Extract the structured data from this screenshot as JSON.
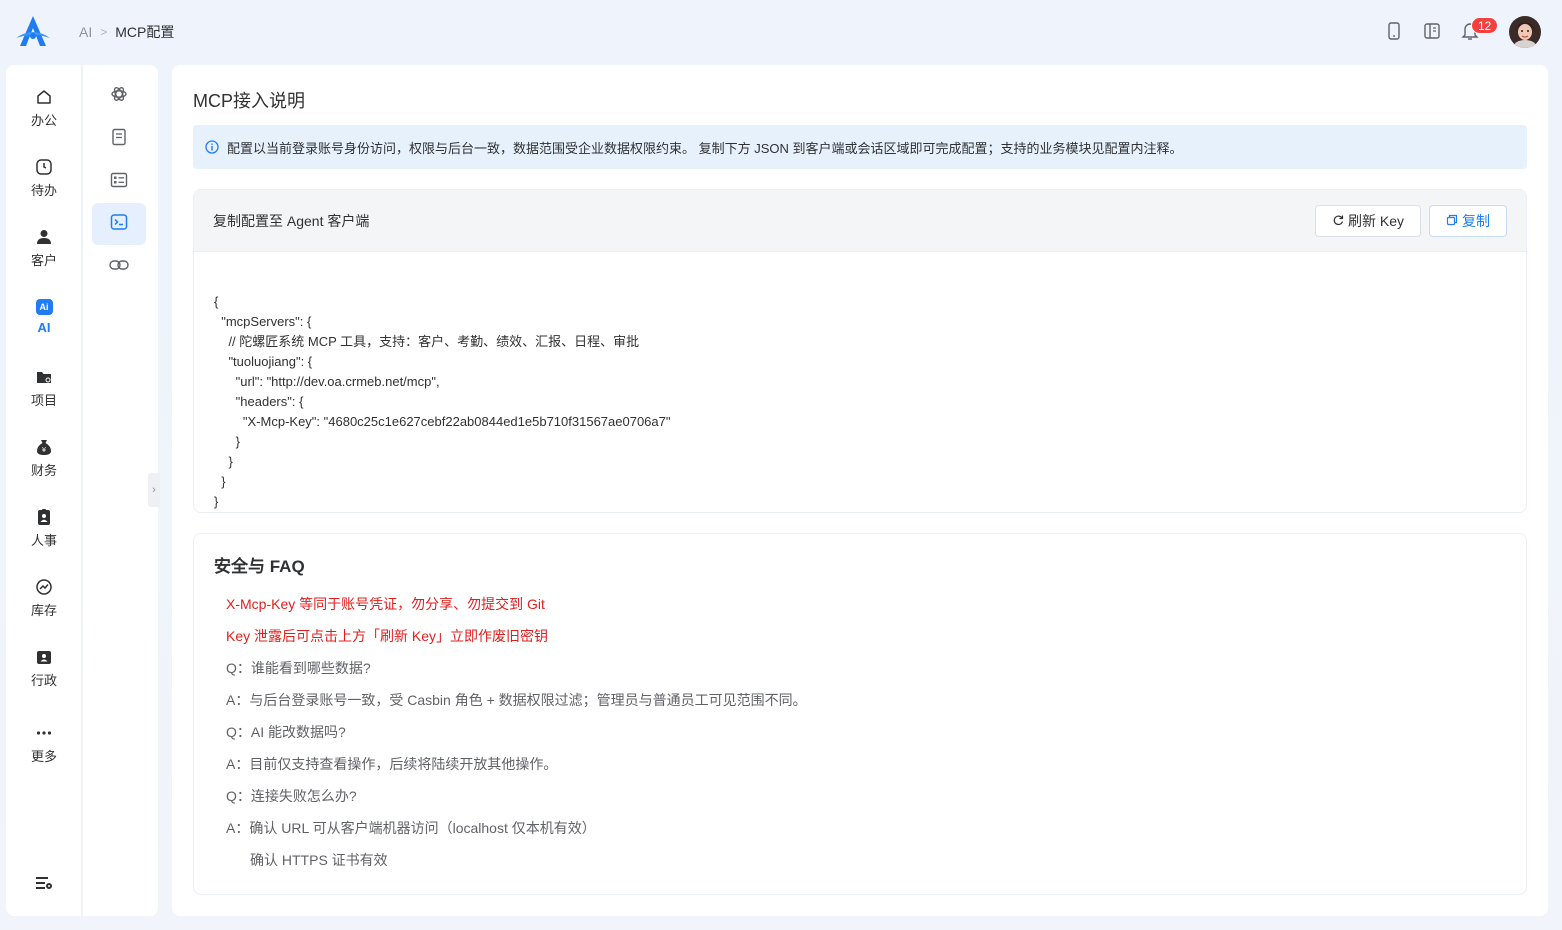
{
  "header": {
    "breadcrumb": [
      "AI",
      "MCP配置"
    ],
    "notification_count": "12"
  },
  "main_nav": [
    {
      "label": "办公",
      "icon": "home-icon"
    },
    {
      "label": "待办",
      "icon": "todo-clock-icon"
    },
    {
      "label": "客户",
      "icon": "customer-icon"
    },
    {
      "label": "AI",
      "icon": "ai-icon",
      "active": true,
      "chip": "Ai"
    },
    {
      "label": "项目",
      "icon": "folder-icon"
    },
    {
      "label": "财务",
      "icon": "money-bag-icon"
    },
    {
      "label": "人事",
      "icon": "badge-icon"
    },
    {
      "label": "库存",
      "icon": "trend-icon"
    },
    {
      "label": "行政",
      "icon": "admin-icon"
    },
    {
      "label": "更多",
      "icon": "more-icon"
    }
  ],
  "sub_nav": [
    {
      "icon": "openai-icon"
    },
    {
      "icon": "document-icon"
    },
    {
      "icon": "checklist-icon"
    },
    {
      "icon": "terminal-icon",
      "active": true
    },
    {
      "icon": "link-icon"
    }
  ],
  "main": {
    "title": "MCP接入说明",
    "alert": "配置以当前登录账号身份访问，权限与后台一致，数据范围受企业数据权限约束。 复制下方 JSON 到客户端或会话区域即可完成配置；支持的业务模块见配置内注释。",
    "config": {
      "title": "复制配置至 Agent 客户端",
      "refresh_label": "刷新 Key",
      "copy_label": "复制",
      "code_lines": [
        "{",
        "  \"mcpServers\": {",
        "    // 陀螺匠系统 MCP 工具，支持：客户、考勤、绩效、汇报、日程、审批",
        "    \"tuoluojiang\": {",
        "      \"url\": \"http://dev.oa.crmeb.net/mcp\",",
        "      \"headers\": {",
        "        \"X-Mcp-Key\": \"4680c25c1e627cebf22ab0844ed1e5b710f31567ae0706a7\"",
        "      }",
        "    }",
        "  }",
        "}"
      ]
    },
    "faq": {
      "title": "安全与 FAQ",
      "warnings": [
        "X-Mcp-Key 等同于账号凭证，勿分享、勿提交到 Git",
        "Key 泄露后可点击上方「刷新 Key」立即作废旧密钥"
      ],
      "items": [
        "Q：谁能看到哪些数据?",
        "A：与后台登录账号一致，受 Casbin 角色 + 数据权限过滤；管理员与普通员工可见范围不同。",
        "Q：AI 能改数据吗?",
        "A：目前仅支持查看操作，后续将陆续开放其他操作。",
        "Q：连接失败怎么办?",
        "A：确认 URL 可从客户端机器访问（localhost 仅本机有效）"
      ],
      "extra": "确认 HTTPS 证书有效"
    }
  },
  "colors": {
    "accent": "#1f7cf2",
    "warn": "#e0201c",
    "badge": "#f5403d"
  }
}
